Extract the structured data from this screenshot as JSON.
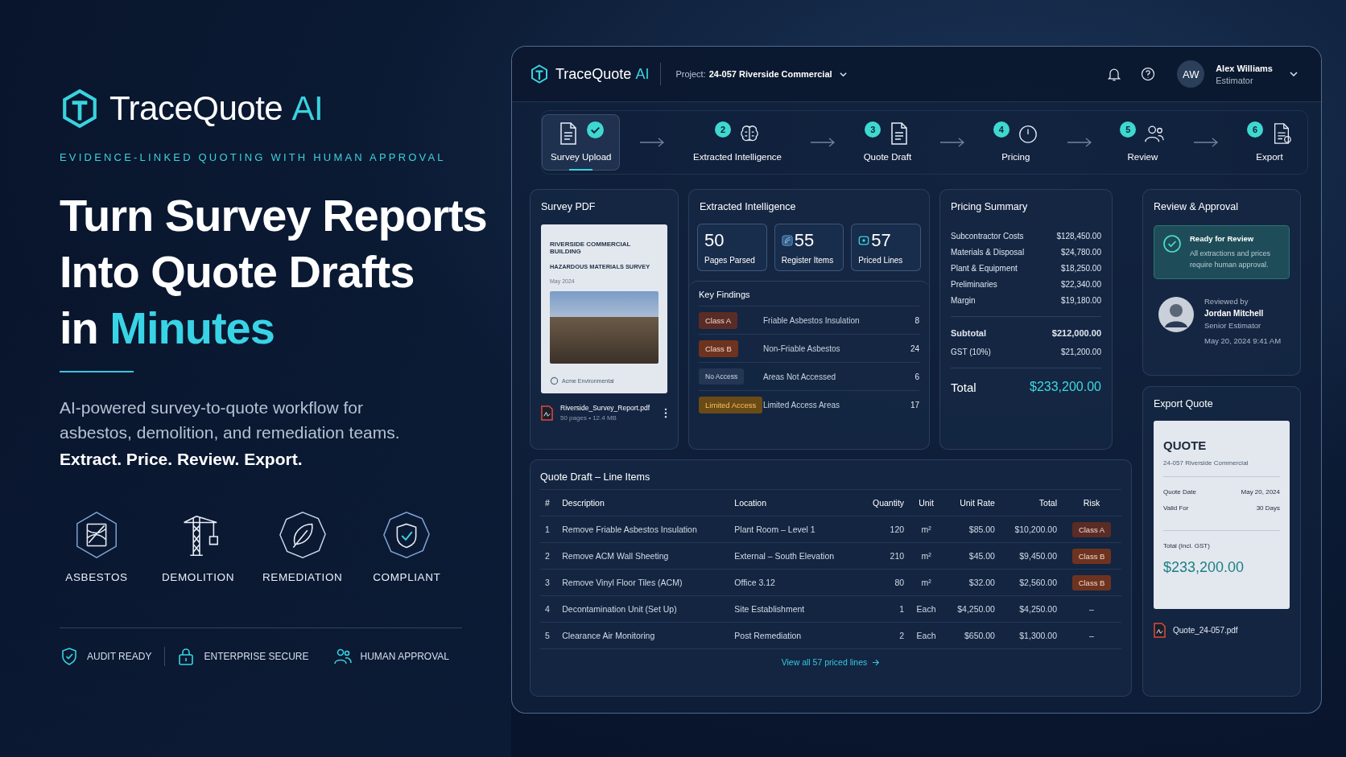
{
  "hero": {
    "brand": {
      "name": "TraceQuote",
      "suffix": "AI"
    },
    "tagline": "EVIDENCE-LINKED QUOTING WITH HUMAN APPROVAL",
    "headline": [
      {
        "text": "Turn Survey Reports"
      },
      {
        "text": "Into Quote Drafts"
      },
      {
        "text": "in",
        "highlight": "Minutes"
      }
    ],
    "description": "AI-powered survey-to-quote workflow for asbestos, demolition, and remediation teams.",
    "slogan": "Extract. Price. Review. Export.",
    "services": [
      {
        "kind": "asbestos",
        "label": "ASBESTOS"
      },
      {
        "kind": "demolition",
        "label": "DEMOLITION"
      },
      {
        "kind": "remediation",
        "label": "REMEDIATION"
      },
      {
        "kind": "compliant",
        "label": "COMPLIANT"
      }
    ],
    "badges": [
      {
        "kind": "shield",
        "label": "AUDIT READY"
      },
      {
        "kind": "lock",
        "label": "ENTERPRISE SECURE"
      },
      {
        "kind": "people",
        "label": "HUMAN APPROVAL"
      }
    ]
  },
  "app": {
    "brand": {
      "name": "TraceQuote",
      "suffix": "AI"
    },
    "project": {
      "label": "Project:",
      "value": "24-057 Riverside Commercial"
    },
    "user": {
      "initials": "AW",
      "name": "Alex Williams",
      "role": "Estimator"
    },
    "steps": [
      {
        "kind": "upload",
        "label": "Survey Upload",
        "done": true,
        "selected": true
      },
      {
        "kind": "brain",
        "label": "Extracted Intelligence",
        "number": "2",
        "done": false,
        "selected": false
      },
      {
        "kind": "draft",
        "label": "Quote Draft",
        "number": "3",
        "done": false,
        "selected": false
      },
      {
        "kind": "pricing",
        "label": "Pricing",
        "number": "4",
        "done": false,
        "selected": false
      },
      {
        "kind": "review",
        "label": "Review",
        "number": "5",
        "done": false,
        "selected": false
      },
      {
        "kind": "export",
        "label": "Export",
        "number": "6",
        "done": false,
        "selected": false
      }
    ],
    "survey": {
      "title": "Survey PDF",
      "doc_title": "RIVERSIDE COMMERCIAL BUILDING",
      "doc_subtitle": "HAZARDOUS MATERIALS SURVEY",
      "doc_date": "May 2024",
      "doc_company": "Acme Environmental",
      "file_name": "Riverside_Survey_Report.pdf",
      "file_meta": "50 pages • 12.4 MB"
    },
    "extracted": {
      "title": "Extracted Intelligence",
      "stats": [
        {
          "kind": "pages",
          "value": "50",
          "label": "Pages Parsed"
        },
        {
          "kind": "register",
          "value": "55",
          "label": "Register Items"
        },
        {
          "kind": "priced",
          "value": "57",
          "label": "Priced Lines"
        }
      ],
      "findings_title": "Key Findings",
      "findings": [
        {
          "kind": "class_a",
          "tag": "Class A",
          "label": "Friable Asbestos Insulation",
          "count": "8"
        },
        {
          "kind": "class_b",
          "tag": "Class B",
          "label": "Non-Friable Asbestos",
          "count": "24"
        },
        {
          "kind": "no_access",
          "tag": "No Access",
          "label": "Areas Not Accessed",
          "count": "6"
        },
        {
          "kind": "limited",
          "tag": "Limited Access",
          "label": "Limited Access Areas",
          "count": "17"
        }
      ]
    },
    "pricing": {
      "title": "Pricing Summary",
      "lines": [
        {
          "label": "Subcontractor Costs",
          "value": "$128,450.00"
        },
        {
          "label": "Materials & Disposal",
          "value": "$24,780.00"
        },
        {
          "label": "Plant & Equipment",
          "value": "$18,250.00"
        },
        {
          "label": "Preliminaries",
          "value": "$22,340.00"
        },
        {
          "label": "Margin",
          "value": "$19,180.00"
        }
      ],
      "subtotal": {
        "label": "Subtotal",
        "value": "$212,000.00"
      },
      "gst": {
        "label": "GST (10%)",
        "value": "$21,200.00"
      },
      "total": {
        "label": "Total",
        "value": "$233,200.00"
      }
    },
    "review": {
      "title": "Review & Approval",
      "status_title": "Ready for Review",
      "status_text": "All extractions and prices require human approval.",
      "approved": true,
      "reviewed_label": "Reviewed by",
      "reviewer": "Jordan Mitchell",
      "reviewer_role": "Senior Estimator",
      "reviewed_at": "May 20, 2024 9:41 AM"
    },
    "line_items": {
      "title": "Quote Draft – Line Items",
      "columns": [
        "#",
        "Description",
        "Location",
        "Quantity",
        "Unit",
        "Unit Rate",
        "Total",
        "Risk"
      ],
      "rows": [
        {
          "cells": [
            "1",
            "Remove Friable Asbestos Insulation",
            "Plant Room – Level 1",
            "120",
            "m²",
            "$85.00",
            "$10,200.00"
          ],
          "risk": {
            "kind": "class_a",
            "text": "Class A"
          }
        },
        {
          "cells": [
            "2",
            "Remove ACM Wall Sheeting",
            "External – South Elevation",
            "210",
            "m²",
            "$45.00",
            "$9,450.00"
          ],
          "risk": {
            "kind": "class_b",
            "text": "Class B"
          }
        },
        {
          "cells": [
            "3",
            "Remove Vinyl Floor Tiles (ACM)",
            "Office 3.12",
            "80",
            "m²",
            "$32.00",
            "$2,560.00"
          ],
          "risk": {
            "kind": "class_b",
            "text": "Class B"
          }
        },
        {
          "cells": [
            "4",
            "Decontamination Unit (Set Up)",
            "Site Establishment",
            "1",
            "Each",
            "$4,250.00",
            "$4,250.00"
          ],
          "risk": {
            "kind": "none",
            "text": "–"
          }
        },
        {
          "cells": [
            "5",
            "Clearance Air Monitoring",
            "Post Remediation",
            "2",
            "Each",
            "$650.00",
            "$1,300.00"
          ],
          "risk": {
            "kind": "none",
            "text": "–"
          }
        }
      ],
      "link": "View all 57 priced lines"
    },
    "export": {
      "title": "Export Quote",
      "doc_title": "QUOTE",
      "doc_project": "24-057 Riverside Commercial",
      "fields": [
        {
          "label": "Quote Date",
          "value": "May 20, 2024"
        },
        {
          "label": "Valid For",
          "value": "30 Days"
        }
      ],
      "total_label": "Total (Incl. GST)",
      "total": "$233,200.00",
      "file_name": "Quote_24-057.pdf"
    }
  }
}
